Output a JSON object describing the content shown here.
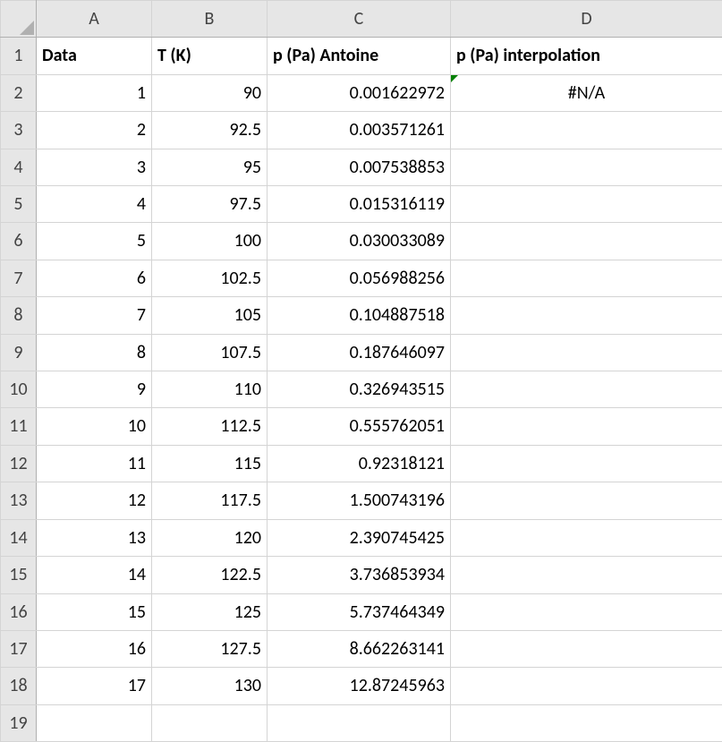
{
  "col_letters": [
    "A",
    "B",
    "C",
    "D"
  ],
  "row_numbers": [
    "1",
    "2",
    "3",
    "4",
    "5",
    "6",
    "7",
    "8",
    "9",
    "10",
    "11",
    "12",
    "13",
    "14",
    "15",
    "16",
    "17",
    "18",
    "19"
  ],
  "headers": {
    "A": "Data",
    "B": "T (K)",
    "C": "p (Pa) Antoine",
    "D": "p (Pa) interpolation"
  },
  "rows": [
    {
      "A": "1",
      "B": "90",
      "C": "0.001622972",
      "D": "#N/A"
    },
    {
      "A": "2",
      "B": "92.5",
      "C": "0.003571261",
      "D": ""
    },
    {
      "A": "3",
      "B": "95",
      "C": "0.007538853",
      "D": ""
    },
    {
      "A": "4",
      "B": "97.5",
      "C": "0.015316119",
      "D": ""
    },
    {
      "A": "5",
      "B": "100",
      "C": "0.030033089",
      "D": ""
    },
    {
      "A": "6",
      "B": "102.5",
      "C": "0.056988256",
      "D": ""
    },
    {
      "A": "7",
      "B": "105",
      "C": "0.104887518",
      "D": ""
    },
    {
      "A": "8",
      "B": "107.5",
      "C": "0.187646097",
      "D": ""
    },
    {
      "A": "9",
      "B": "110",
      "C": "0.326943515",
      "D": ""
    },
    {
      "A": "10",
      "B": "112.5",
      "C": "0.555762051",
      "D": ""
    },
    {
      "A": "11",
      "B": "115",
      "C": "0.92318121",
      "D": ""
    },
    {
      "A": "12",
      "B": "117.5",
      "C": "1.500743196",
      "D": ""
    },
    {
      "A": "13",
      "B": "120",
      "C": "2.390745425",
      "D": ""
    },
    {
      "A": "14",
      "B": "122.5",
      "C": "3.736853934",
      "D": ""
    },
    {
      "A": "15",
      "B": "125",
      "C": "5.737464349",
      "D": ""
    },
    {
      "A": "16",
      "B": "127.5",
      "C": "8.662263141",
      "D": ""
    },
    {
      "A": "17",
      "B": "130",
      "C": "12.87245963",
      "D": ""
    },
    {
      "A": "",
      "B": "",
      "C": "",
      "D": ""
    }
  ]
}
